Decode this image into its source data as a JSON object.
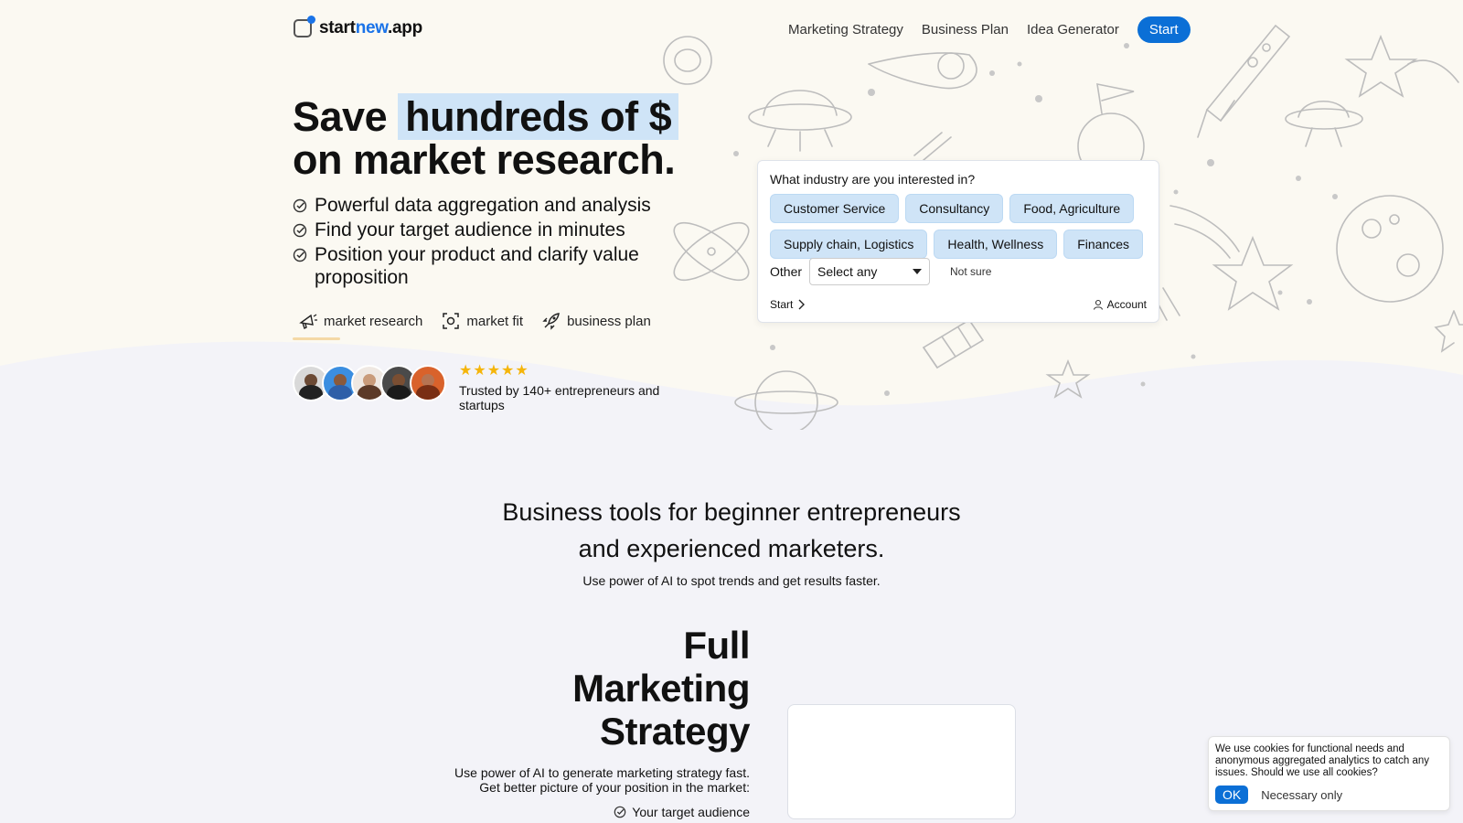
{
  "brand": {
    "name_prefix": "start",
    "name_accent": "new",
    "name_suffix": ".app",
    "accent_color": "#1a73e8"
  },
  "nav": {
    "items": [
      "Marketing Strategy",
      "Business Plan",
      "Idea Generator"
    ],
    "start_label": "Start",
    "start_color": "#0b6fd6"
  },
  "hero": {
    "headline_pre": "Save ",
    "headline_highlight": "hundreds of $",
    "headline_post": " on market research.",
    "benefits": [
      "Powerful data aggregation and analysis",
      "Find your target audience in minutes",
      "Position your product and clarify value proposition"
    ],
    "tags": [
      {
        "label": "market research",
        "icon": "megaphone-icon"
      },
      {
        "label": "market fit",
        "icon": "focus-icon"
      },
      {
        "label": "business plan",
        "icon": "rocket-icon"
      }
    ],
    "rating_stars": 5,
    "trust_text": "Trusted by 140+ entrepreneurs and startups"
  },
  "industry_card": {
    "question": "What industry are you interested in?",
    "chips": [
      "Customer Service",
      "Consultancy",
      "Food, Agriculture",
      "Supply chain, Logistics",
      "Health, Wellness",
      "Finances"
    ],
    "other_label": "Other",
    "select_value": "Select any",
    "not_sure_label": "Not sure",
    "start_label": "Start",
    "account_label": "Account"
  },
  "section": {
    "title_line1": "Business tools for beginner entrepreneurs",
    "title_line2": "and experienced marketers.",
    "subtitle": "Use power of AI to spot trends and get results faster."
  },
  "feature": {
    "title_line1": "Full",
    "title_line2": "Marketing",
    "title_line3": "Strategy",
    "desc_line1": "Use power of AI to generate marketing strategy fast.",
    "desc_line2": "Get better picture of your position in the market:",
    "first_item": "Your target audience"
  },
  "cookie": {
    "text": "We use cookies for functional needs and anonymous aggregated analytics to catch any issues. Should we use all cookies?",
    "ok_label": "OK",
    "necessary_label": "Necessary only"
  }
}
